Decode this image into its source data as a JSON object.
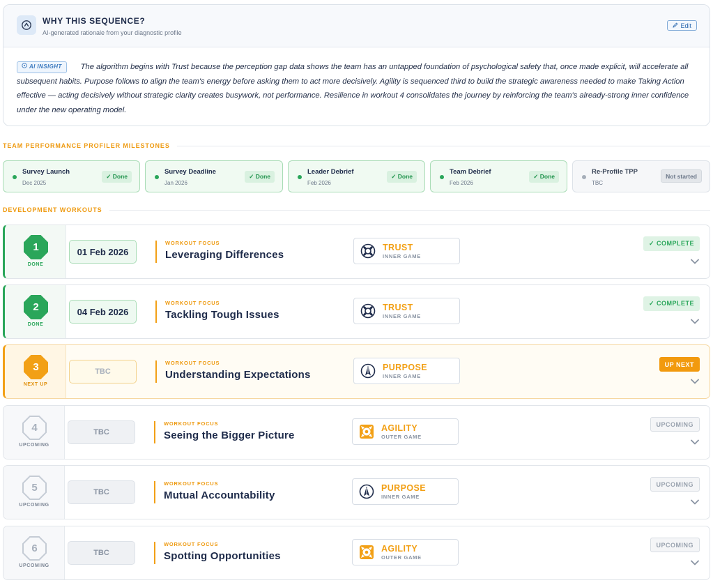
{
  "rationale": {
    "title": "WHY THIS SEQUENCE?",
    "subtitle": "AI-generated rationale from your diagnostic profile",
    "edit_label": "Edit",
    "ai_badge": "AI INSIGHT",
    "text": "The algorithm begins with Trust because the perception gap data shows the team has an untapped foundation of psychological safety that, once made explicit, will accelerate all subsequent habits. Purpose follows to align the team's energy before asking them to act more decisively. Agility is sequenced third to build the strategic awareness needed to make Taking Action effective — acting decisively without strategic clarity creates busywork, not performance. Resilience in workout 4 consolidates the journey by reinforcing the team's already-strong inner confidence under the new operating model."
  },
  "milestones_section": {
    "label": "TEAM PERFORMANCE PROFILER MILESTONES"
  },
  "milestones": [
    {
      "name": "Survey Launch",
      "date": "Dec 2025",
      "status": "✓ Done"
    },
    {
      "name": "Survey Deadline",
      "date": "Jan 2026",
      "status": "✓ Done"
    },
    {
      "name": "Leader Debrief",
      "date": "Feb 2026",
      "status": "✓ Done"
    },
    {
      "name": "Team Debrief",
      "date": "Feb 2026",
      "status": "✓ Done"
    },
    {
      "name": "Re-Profile TPP",
      "date": "TBC",
      "status": "Not started"
    }
  ],
  "workouts_section": {
    "label": "DEVELOPMENT WORKOUTS"
  },
  "workouts": [
    {
      "number": "1",
      "state_label": "DONE",
      "date": "01 Feb 2026",
      "focus_label": "WORKOUT FOCUS",
      "title": "Leveraging Differences",
      "game": "TRUST",
      "game_type": "INNER GAME",
      "status": "✓ COMPLETE"
    },
    {
      "number": "2",
      "state_label": "DONE",
      "date": "04 Feb 2026",
      "focus_label": "WORKOUT FOCUS",
      "title": "Tackling Tough Issues",
      "game": "TRUST",
      "game_type": "INNER GAME",
      "status": "✓ COMPLETE"
    },
    {
      "number": "3",
      "state_label": "NEXT UP",
      "date": "TBC",
      "focus_label": "WORKOUT FOCUS",
      "title": "Understanding Expectations",
      "game": "PURPOSE",
      "game_type": "INNER GAME",
      "status": "UP NEXT"
    },
    {
      "number": "4",
      "state_label": "UPCOMING",
      "date": "TBC",
      "focus_label": "WORKOUT FOCUS",
      "title": "Seeing the Bigger Picture",
      "game": "AGILITY",
      "game_type": "OUTER GAME",
      "status": "UPCOMING"
    },
    {
      "number": "5",
      "state_label": "UPCOMING",
      "date": "TBC",
      "focus_label": "WORKOUT FOCUS",
      "title": "Mutual Accountability",
      "game": "PURPOSE",
      "game_type": "INNER GAME",
      "status": "UPCOMING"
    },
    {
      "number": "6",
      "state_label": "UPCOMING",
      "date": "TBC",
      "focus_label": "WORKOUT FOCUS",
      "title": "Spotting Opportunities",
      "game": "AGILITY",
      "game_type": "OUTER GAME",
      "status": "UPCOMING"
    }
  ],
  "icons": {
    "header": "compass-icon",
    "edit": "pencil-icon",
    "ai": "sparkle-icon",
    "trust": "trust-lifebuoy-icon",
    "purpose": "purpose-arrow-icon",
    "agility": "agility-arrows-icon",
    "expand": "chevron-down-icon"
  },
  "colors": {
    "accent": "#f2a016",
    "done": "#2aa65a",
    "navy": "#1e2b4a",
    "muted": "#8a94a3"
  }
}
